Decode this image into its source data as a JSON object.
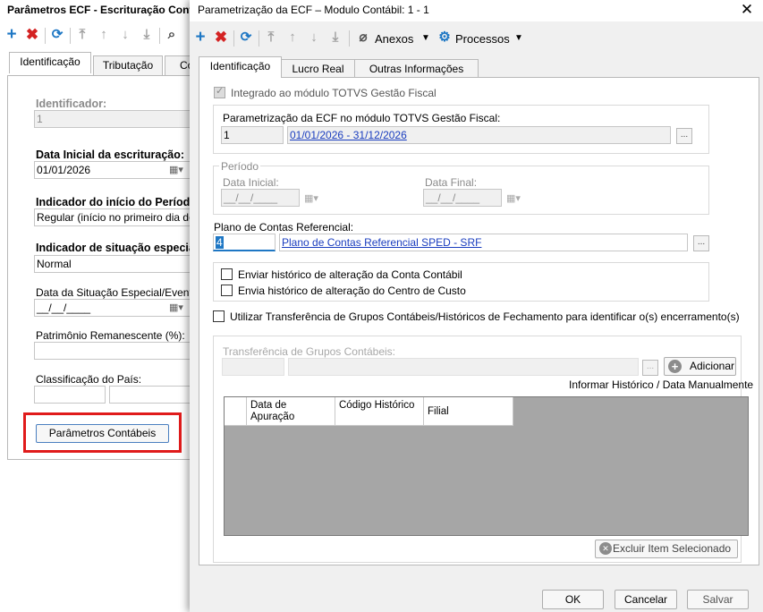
{
  "background_window": {
    "title": "Parâmetros ECF - Escrituração Contá",
    "tabs": [
      "Identificação",
      "Tributação",
      "Co"
    ],
    "fields": {
      "identificador_label": "Identificador:",
      "identificador_value": "1",
      "data_inicial_label": "Data Inicial da escrituração:",
      "data_inicial_value": "01/01/2026",
      "indicador_inicio_label": "Indicador do início do Período",
      "indicador_inicio_value": "Regular (início no primeiro dia do an",
      "indicador_situacao_label": "Indicador de situação especial",
      "indicador_situacao_value": "Normal",
      "data_situacao_label": "Data da Situação Especial/Evento:",
      "data_situacao_value": "__/__/____",
      "patrimonio_label": "Patrimônio Remanescente (%):",
      "classificacao_label": "Classificação do País:"
    },
    "parametros_button": "Parâmetros Contábeis"
  },
  "dialog": {
    "title": "Parametrização da ECF – Modulo Contábil: 1 - 1",
    "toolbar": {
      "anexos": "Anexos",
      "processos": "Processos"
    },
    "tabs": [
      "Identificação",
      "Lucro Real",
      "Outras Informações"
    ],
    "integrado_label": "Integrado ao módulo TOTVS Gestão Fiscal",
    "parametrizacao": {
      "label": "Parametrização da ECF no módulo TOTVS Gestão Fiscal:",
      "code": "1",
      "description": "01/01/2026 - 31/12/2026",
      "lookup": "..."
    },
    "periodo": {
      "legend": "Período",
      "data_inicial_label": "Data Inicial:",
      "data_inicial_value": "__/__/____",
      "data_final_label": "Data Final:",
      "data_final_value": "__/__/____"
    },
    "plano": {
      "label": "Plano de Contas Referencial:",
      "code": "4",
      "description": "Plano de Contas Referencial SPED - SRF",
      "lookup": "..."
    },
    "enviar_historico_conta": "Enviar histórico de alteração da Conta Contábil",
    "enviar_historico_centro": "Envia histórico de alteração do Centro de Custo",
    "utilizar_transferencia": "Utilizar Transferência de Grupos Contábeis/Históricos de Fechamento para identificar o(s) encerramento(s)",
    "transferencia": {
      "label": "Transferência de Grupos Contábeis:",
      "lookup": "...",
      "adicionar": "Adicionar",
      "informar": "Informar Histórico / Data Manualmente",
      "columns": [
        "Data de Apuração",
        "Código Histórico",
        "Filial"
      ],
      "excluir": "Excluir Item Selecionado"
    },
    "buttons": {
      "ok": "OK",
      "cancelar": "Cancelar",
      "salvar": "Salvar"
    }
  },
  "colors": {
    "accent_blue": "#1e77c4",
    "delete_red": "#d42222",
    "highlight_red": "#e01b1b",
    "link_blue": "#1a3dbf",
    "grid_gray": "#a6a6a6"
  }
}
